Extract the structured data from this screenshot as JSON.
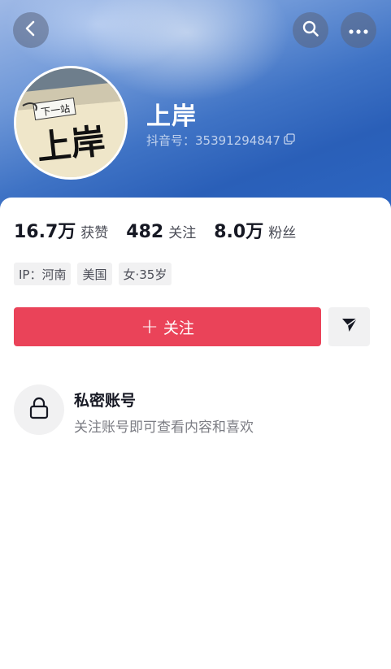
{
  "header": {
    "back_icon": "chevron-left-icon",
    "search_icon": "search-icon",
    "more_icon": "more-dots-icon"
  },
  "profile": {
    "avatar_text_small": "下一站",
    "avatar_text_large": "上岸",
    "name": "上岸",
    "douyin_id": "抖音号：35391294847",
    "copy_icon": "copy-icon"
  },
  "stats": [
    {
      "value": "16.7万",
      "label": "获赞"
    },
    {
      "value": "482",
      "label": "关注"
    },
    {
      "value": "8.0万",
      "label": "粉丝"
    }
  ],
  "tags": [
    "IP：河南",
    "美国",
    "女·35岁"
  ],
  "actions": {
    "follow_plus": "+",
    "follow_label": "关注",
    "share_icon": "send-icon"
  },
  "private": {
    "icon": "lock-icon",
    "title": "私密账号",
    "description": "关注账号即可查看内容和喜欢"
  },
  "colors": {
    "follow_button": "#ea4359",
    "header_blue": "#2a5fb8"
  }
}
